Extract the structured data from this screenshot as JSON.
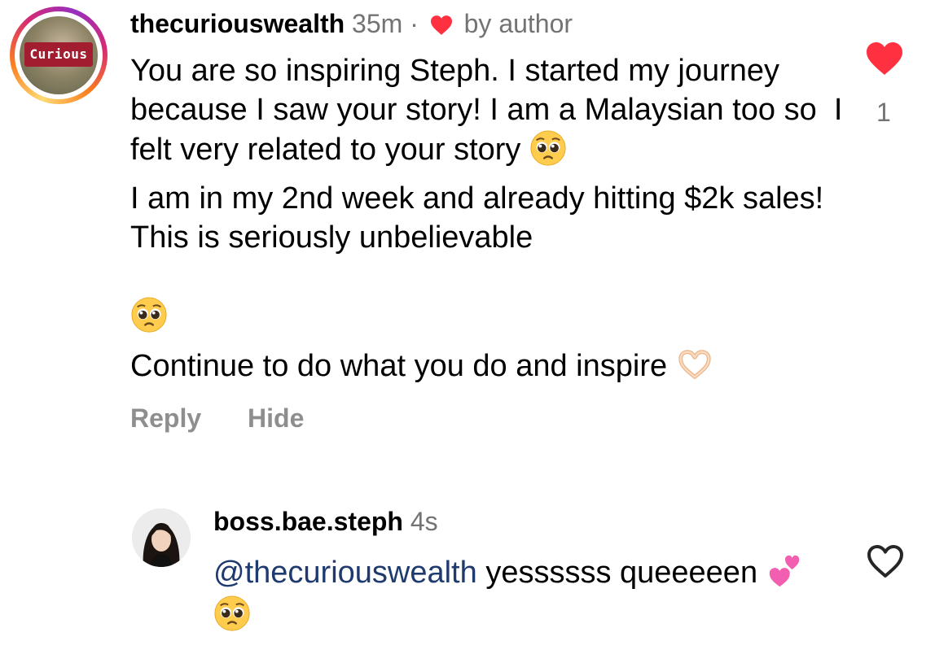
{
  "comments": [
    {
      "username": "thecuriouswealth",
      "time": "35m",
      "separator": "·",
      "author_badge": "by author",
      "avatar_logo_text": "Curious",
      "paragraphs": [
        "You are so inspiring Steph. I started my journey because I saw your story! I am a Malaysian too so  I felt very related to your story",
        "I am in my 2nd week and already hitting $2k sales! This is seriously unbelievable",
        "Continue to do what you do and inspire"
      ],
      "actions": {
        "reply": "Reply",
        "hide": "Hide"
      },
      "like_count": "1",
      "liked": true
    },
    {
      "username": "boss.bae.steph",
      "time": "4s",
      "mention": "@thecuriouswealth",
      "text": "yessssss queeeeen",
      "liked": false
    }
  ],
  "colors": {
    "heart_red": "#ff3040",
    "meta_gray": "#737373",
    "action_gray": "#8e8e8e",
    "mention_blue": "#1e3a6e"
  },
  "icons": [
    "heart-filled-icon",
    "heart-outline-icon",
    "pleading-face-emoji",
    "heart-hands-emoji",
    "two-hearts-emoji"
  ]
}
